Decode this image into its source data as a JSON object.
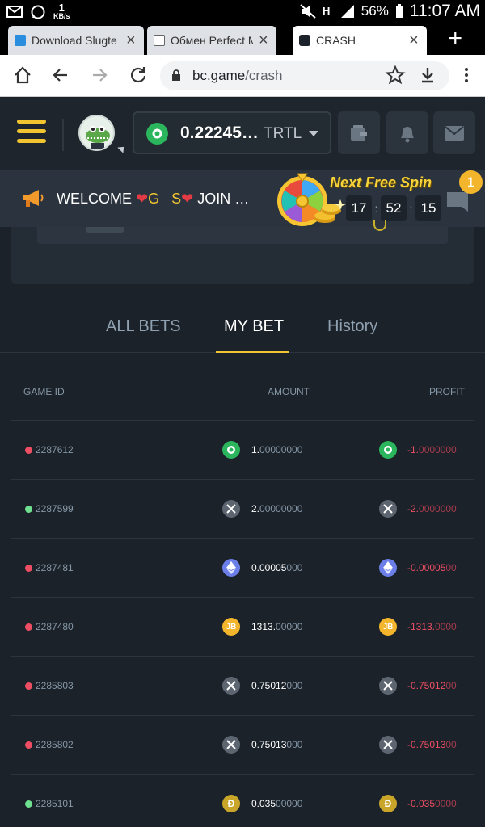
{
  "statusbar": {
    "speed_value": "1",
    "speed_unit": "KB/s",
    "battery": "56%",
    "time": "11:07 AM"
  },
  "browser": {
    "tabs": [
      {
        "label": "Download Slugte",
        "active": false
      },
      {
        "label": "Обмен Perfect M",
        "active": false
      },
      {
        "label": "CRASH",
        "active": true
      }
    ],
    "url_host": "bc.game",
    "url_path": "/crash"
  },
  "header": {
    "balance_value": "0.22245…",
    "balance_currency": "TRTL"
  },
  "announcement": {
    "welcome_prefix": "WELCOME ",
    "welcome_g": "G",
    "welcome_s": "S",
    "welcome_suffix": " JOIN …",
    "free_spin_label": "Next Free Spin",
    "timer_h": "17",
    "timer_m": "52",
    "timer_s": "15",
    "timer_sep": ":",
    "notification_count": "1"
  },
  "tabs": {
    "all_bets": "ALL BETS",
    "my_bet": "MY BET",
    "history": "History"
  },
  "table": {
    "headers": {
      "game_id": "GAME ID",
      "amount": "AMOUNT",
      "profit": "PROFIT"
    },
    "rows": [
      {
        "game_id": "2287612",
        "status": "red",
        "coin": "trtl-icon",
        "amount_main": "1.",
        "amount_tail": "00000000",
        "profit_main": "-1.",
        "profit_tail": "0000000"
      },
      {
        "game_id": "2287599",
        "status": "green",
        "coin": "xrp-icon",
        "amount_main": "2.",
        "amount_tail": "00000000",
        "profit_main": "-2.",
        "profit_tail": "0000000"
      },
      {
        "game_id": "2287481",
        "status": "red",
        "coin": "eth-icon",
        "amount_main": "0.00005",
        "amount_tail": "000",
        "profit_main": "-0.00005",
        "profit_tail": "00"
      },
      {
        "game_id": "2287480",
        "status": "red",
        "coin": "jb-icon",
        "amount_main": "1313.",
        "amount_tail": "00000",
        "profit_main": "-1313.",
        "profit_tail": "0000"
      },
      {
        "game_id": "2285803",
        "status": "red",
        "coin": "xrp-icon",
        "amount_main": "0.75012",
        "amount_tail": "000",
        "profit_main": "-0.75012",
        "profit_tail": "00"
      },
      {
        "game_id": "2285802",
        "status": "red",
        "coin": "xrp-icon",
        "amount_main": "0.75013",
        "amount_tail": "000",
        "profit_main": "-0.75013",
        "profit_tail": "00"
      },
      {
        "game_id": "2285101",
        "status": "green",
        "coin": "doge-icon",
        "amount_main": "0.035",
        "amount_tail": "00000",
        "profit_main": "-0.035",
        "profit_tail": "0000"
      }
    ]
  },
  "colors": {
    "accent": "#f2c530",
    "status_red": "#ee4e63",
    "status_green": "#6ee08f",
    "background": "#1b2229"
  }
}
